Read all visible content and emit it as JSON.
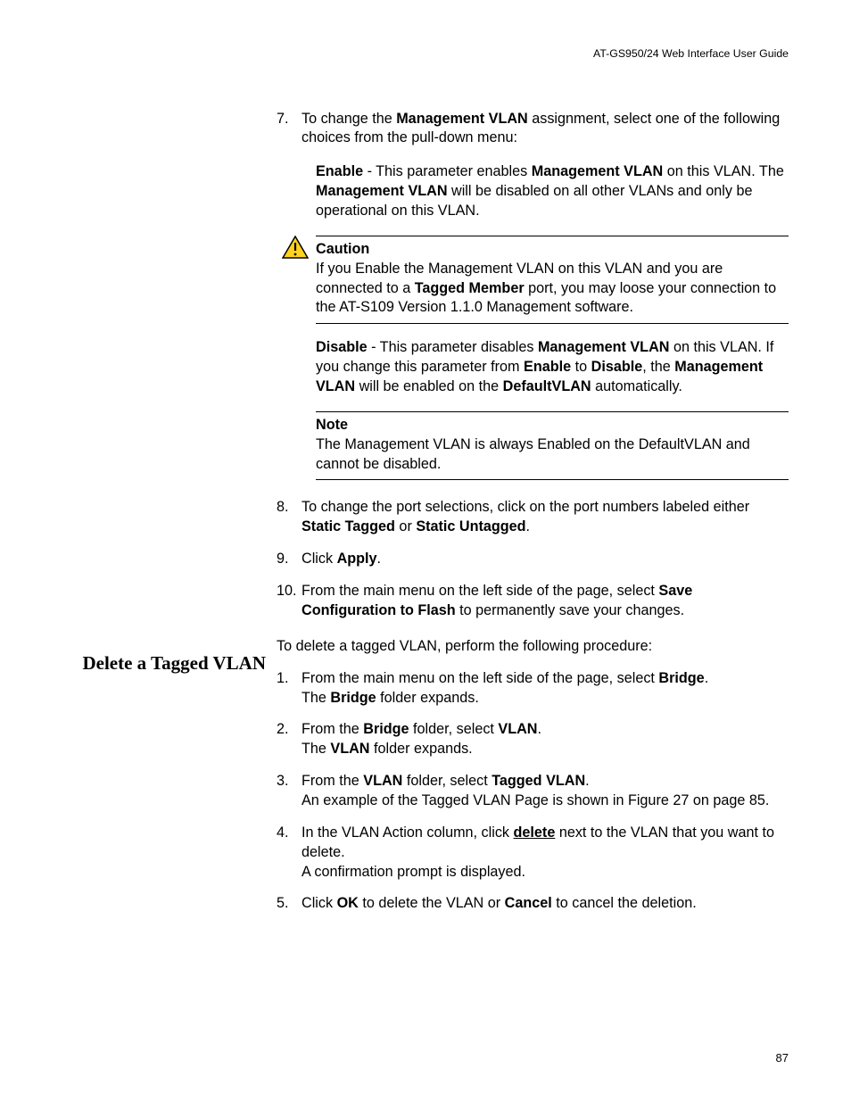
{
  "header": "AT-GS950/24  Web Interface User Guide",
  "page_number": "87",
  "section2": {
    "heading": "Delete a Tagged VLAN",
    "intro": "To delete a tagged VLAN, perform the following procedure:"
  },
  "steps1": {
    "s7": {
      "num": "7.",
      "t1": "To change the ",
      "b1": "Management VLAN",
      "t2": " assignment, select one of the following choices from the pull-down menu:"
    },
    "enable": {
      "b1": "Enable",
      "t1": " - This parameter enables ",
      "b2": "Management VLAN",
      "t2": " on this VLAN. The ",
      "b3": "Management VLAN",
      "t3": " will be disabled on all other VLANs and only be operational on this VLAN."
    },
    "caution": {
      "title": "Caution",
      "t1": "If you Enable the Management VLAN on this VLAN and you are connected to a ",
      "b1": "Tagged Member",
      "t2": " port, you may loose your connection to the AT-S109 Version 1.1.0  Management software."
    },
    "disable": {
      "b1": "Disable",
      "t1": " - This parameter disables ",
      "b2": "Management VLAN",
      "t2": " on this VLAN. If you change this parameter from ",
      "b3": "Enable",
      "t3": " to ",
      "b4": "Disable",
      "t4": ", the ",
      "b5": "Management VLAN",
      "t5": " will be enabled on the ",
      "b6": "DefaultVLAN",
      "t6": " automatically."
    },
    "note": {
      "title": "Note",
      "body": "The Management VLAN is always Enabled on the DefaultVLAN and cannot be disabled."
    },
    "s8": {
      "num": "8.",
      "t1": "To change the port selections, click on the port numbers labeled either ",
      "b1": "Static Tagged",
      "t2": " or ",
      "b2": "Static Untagged",
      "t3": "."
    },
    "s9": {
      "num": "9.",
      "t1": "Click ",
      "b1": "Apply",
      "t2": "."
    },
    "s10": {
      "num": "10.",
      "t1": "From the main menu on the left side of the page, select ",
      "b1": "Save Configuration to Flash",
      "t2": " to permanently save your changes."
    }
  },
  "steps2": {
    "s1": {
      "num": "1.",
      "t1": "From the main menu on the left side of the page, select ",
      "b1": "Bridge",
      "t2": ".",
      "t3": "The ",
      "b2": "Bridge",
      "t4": " folder expands."
    },
    "s2": {
      "num": "2.",
      "t1": "From the ",
      "b1": "Bridge",
      "t2": " folder, select ",
      "b2": "VLAN",
      "t3": ".",
      "t4": "The ",
      "b3": "VLAN",
      "t5": " folder expands."
    },
    "s3": {
      "num": "3.",
      "t1": "From the ",
      "b1": "VLAN",
      "t2": " folder, select ",
      "b2": "Tagged VLAN",
      "t3": ".",
      "t4": "An example of the Tagged VLAN Page is shown in Figure 27 on page 85."
    },
    "s4": {
      "num": "4.",
      "t1": "In the VLAN Action column, click ",
      "ub1": "delete",
      "t2": " next to the VLAN that you want to delete.",
      "t3": "A confirmation prompt is displayed."
    },
    "s5": {
      "num": "5.",
      "t1": "Click ",
      "b1": "OK",
      "t2": " to delete the VLAN or ",
      "b2": "Cancel",
      "t3": " to cancel the deletion."
    }
  }
}
